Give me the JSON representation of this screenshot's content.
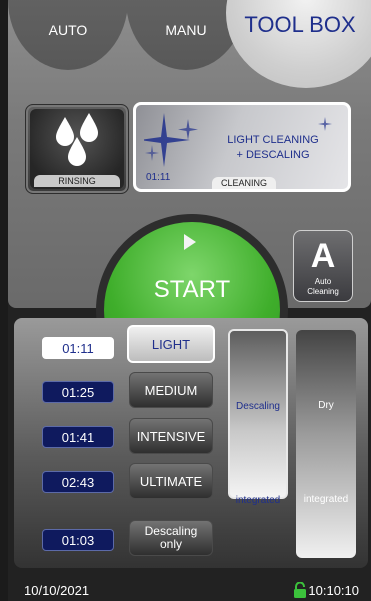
{
  "header": {
    "tab_auto": "AUTO",
    "tab_manu": "MANU",
    "toolbox": "TOOL BOX"
  },
  "modes": {
    "rinsing_label": "RINSING",
    "cleaning_title_line1": "LIGHT CLEANING",
    "cleaning_title_line2": "+ DESCALING",
    "cleaning_time": "01:11",
    "cleaning_label": "CLEANING"
  },
  "start": {
    "label": "START",
    "auto_cleaning_line1": "Auto",
    "auto_cleaning_line2": "Cleaning",
    "auto_letter": "A"
  },
  "programs": [
    {
      "time": "01:11",
      "label": "LIGHT",
      "active": true
    },
    {
      "time": "01:25",
      "label": "MEDIUM",
      "active": false
    },
    {
      "time": "01:41",
      "label": "INTENSIVE",
      "active": false
    },
    {
      "time": "02:43",
      "label": "ULTIMATE",
      "active": false
    },
    {
      "time": "01:03",
      "label_line1": "Descaling",
      "label_line2": "only",
      "active": false
    }
  ],
  "options": {
    "descaling_line1": "Descaling",
    "descaling_line2": "integrated",
    "dry_line1": "Dry",
    "dry_line2": "integrated"
  },
  "status": {
    "date": "10/10/2021",
    "time": "10:10:10"
  },
  "colors": {
    "accent_blue": "#1f2f8c",
    "start_green": "#3fae2b",
    "lock_green": "#3cc23c"
  },
  "icons": [
    "drops-icon",
    "sparkle-icon",
    "play-icon",
    "lock-icon"
  ]
}
